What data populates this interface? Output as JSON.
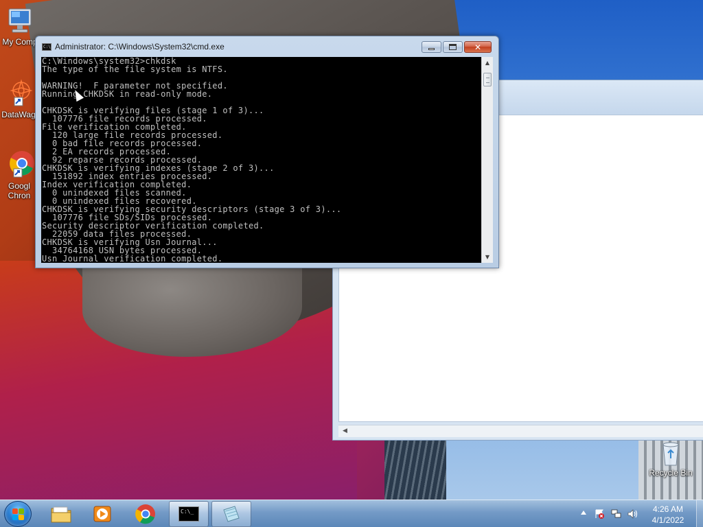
{
  "desktop": {
    "icons": [
      {
        "label": "My Comp",
        "icon": "computer-icon"
      },
      {
        "label": "DataWag",
        "icon": "datawag-icon"
      },
      {
        "label_line1": "Googl",
        "label_line2": "Chron",
        "icon": "chrome-icon"
      },
      {
        "label": "Recycle Bin",
        "icon": "recycle-bin-icon"
      }
    ]
  },
  "cmd_window": {
    "title": "Administrator: C:\\Windows\\System32\\cmd.exe",
    "icon_text": "C:\\",
    "buttons": {
      "minimize": "minimize-icon",
      "maximize": "maximize-icon",
      "close": "close-icon"
    },
    "console_text": "C:\\Windows\\system32>chkdsk\nThe type of the file system is NTFS.\n\nWARNING!  F parameter not specified.\nRunning CHKDSK in read-only mode.\n\nCHKDSK is verifying files (stage 1 of 3)...\n  107776 file records processed.\nFile verification completed.\n  120 large file records processed.\n  0 bad file records processed.\n  2 EA records processed.\n  92 reparse records processed.\nCHKDSK is verifying indexes (stage 2 of 3)...\n  151892 index entries processed.\nIndex verification completed.\n  0 unindexed files scanned.\n  0 unindexed files recovered.\nCHKDSK is verifying security descriptors (stage 3 of 3)...\n  107776 file SDs/SIDs processed.\nSecurity descriptor verification completed.\n  22059 data files processed.\nCHKDSK is verifying Usn Journal...\n  34764168 USN bytes processed.\nUsn Journal verification completed."
  },
  "taskbar": {
    "items": [
      {
        "name": "windows-explorer",
        "icon": "folder-icon"
      },
      {
        "name": "media-player",
        "icon": "media-player-icon"
      },
      {
        "name": "google-chrome",
        "icon": "chrome-icon"
      },
      {
        "name": "command-prompt",
        "icon": "cmd-icon",
        "active": true,
        "icon_text": "C:\\_"
      },
      {
        "name": "notepad",
        "icon": "notepad-icon"
      }
    ],
    "tray": {
      "icons": [
        "show-hidden-icons-arrow",
        "action-center-icon",
        "network-icon",
        "volume-icon"
      ],
      "time": "4:26 AM",
      "date": "4/1/2022"
    }
  },
  "colors": {
    "console_bg": "#000000",
    "console_fg": "#c0c0c0",
    "close_button": "#c2401f"
  }
}
